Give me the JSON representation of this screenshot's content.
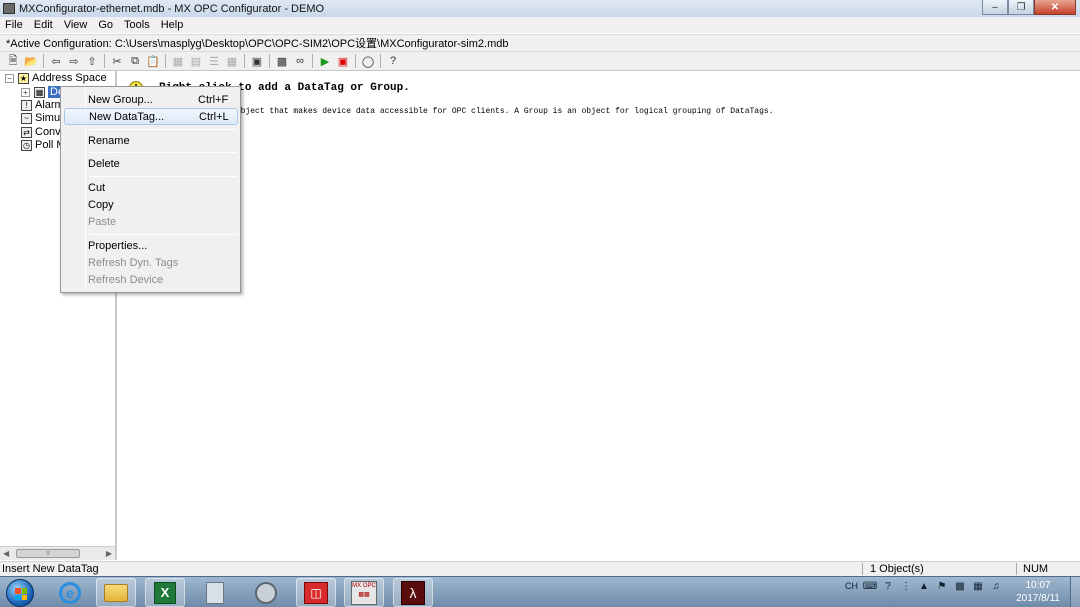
{
  "window": {
    "title": "MXConfigurator-ethernet.mdb - MX OPC Configurator - DEMO",
    "min_glyph": "–",
    "max_glyph": "❐",
    "close_glyph": "✕"
  },
  "menubar": [
    "File",
    "Edit",
    "View",
    "Go",
    "Tools",
    "Help"
  ],
  "config": {
    "text": "*Active Configuration:  C:\\Users\\masplyg\\Desktop\\OPC\\OPC-SIM2\\OPC设置\\MXConfigurator-sim2.mdb"
  },
  "tree": {
    "root": "Address Space",
    "device": "Dev",
    "alarm": "Alarm",
    "simulation": "Simul",
    "conversion": "Conv",
    "poll": "Poll M"
  },
  "main": {
    "hint_title": "Right-click to add a DataTag or Group.",
    "hint_body": "A DataTag is an object that makes device data accessible for OPC clients. A Group is an object for logical grouping of DataTags."
  },
  "context_menu": {
    "new_group": "New Group...",
    "new_group_shortcut": "Ctrl+F",
    "new_datatag": "New DataTag...",
    "new_datatag_shortcut": "Ctrl+L",
    "rename": "Rename",
    "delete": "Delete",
    "cut": "Cut",
    "copy": "Copy",
    "paste": "Paste",
    "properties": "Properties...",
    "refresh_dyn_tags": "Refresh Dyn. Tags",
    "refresh_device": "Refresh Device"
  },
  "statusbar": {
    "message": "Insert New DataTag",
    "objects": "1 Object(s)",
    "num": "NUM"
  },
  "taskbar": {
    "mxopc_label": "MX OPC",
    "ime": "CH",
    "time": "10:07",
    "date": "2017/8/11"
  }
}
